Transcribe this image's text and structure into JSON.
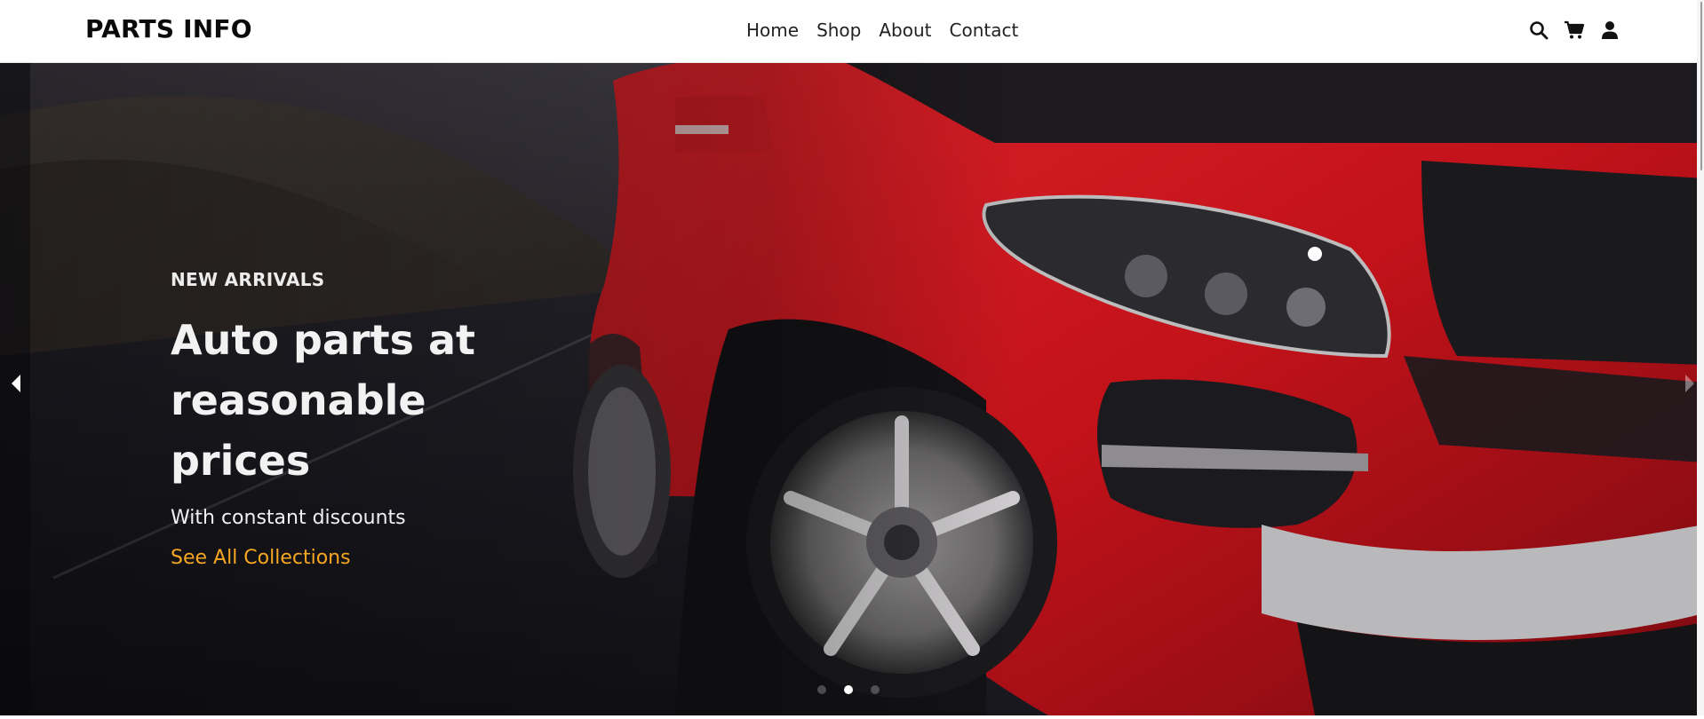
{
  "header": {
    "logo": "PARTS INFO",
    "nav": [
      {
        "label": "Home"
      },
      {
        "label": "Shop"
      },
      {
        "label": "About"
      },
      {
        "label": "Contact"
      }
    ],
    "icons": [
      "search-icon",
      "cart-icon",
      "user-icon"
    ]
  },
  "hero": {
    "eyebrow": "NEW ARRIVALS",
    "headline_line1": "Auto parts at reasonable",
    "headline_line2": "prices",
    "subline": "With constant discounts",
    "cta": "See All Collections",
    "slide_count": 3,
    "active_slide": 2
  },
  "colors": {
    "accent": "#f5a623",
    "car_red": "#c8141c",
    "hero_dark": "#1d1c24"
  }
}
